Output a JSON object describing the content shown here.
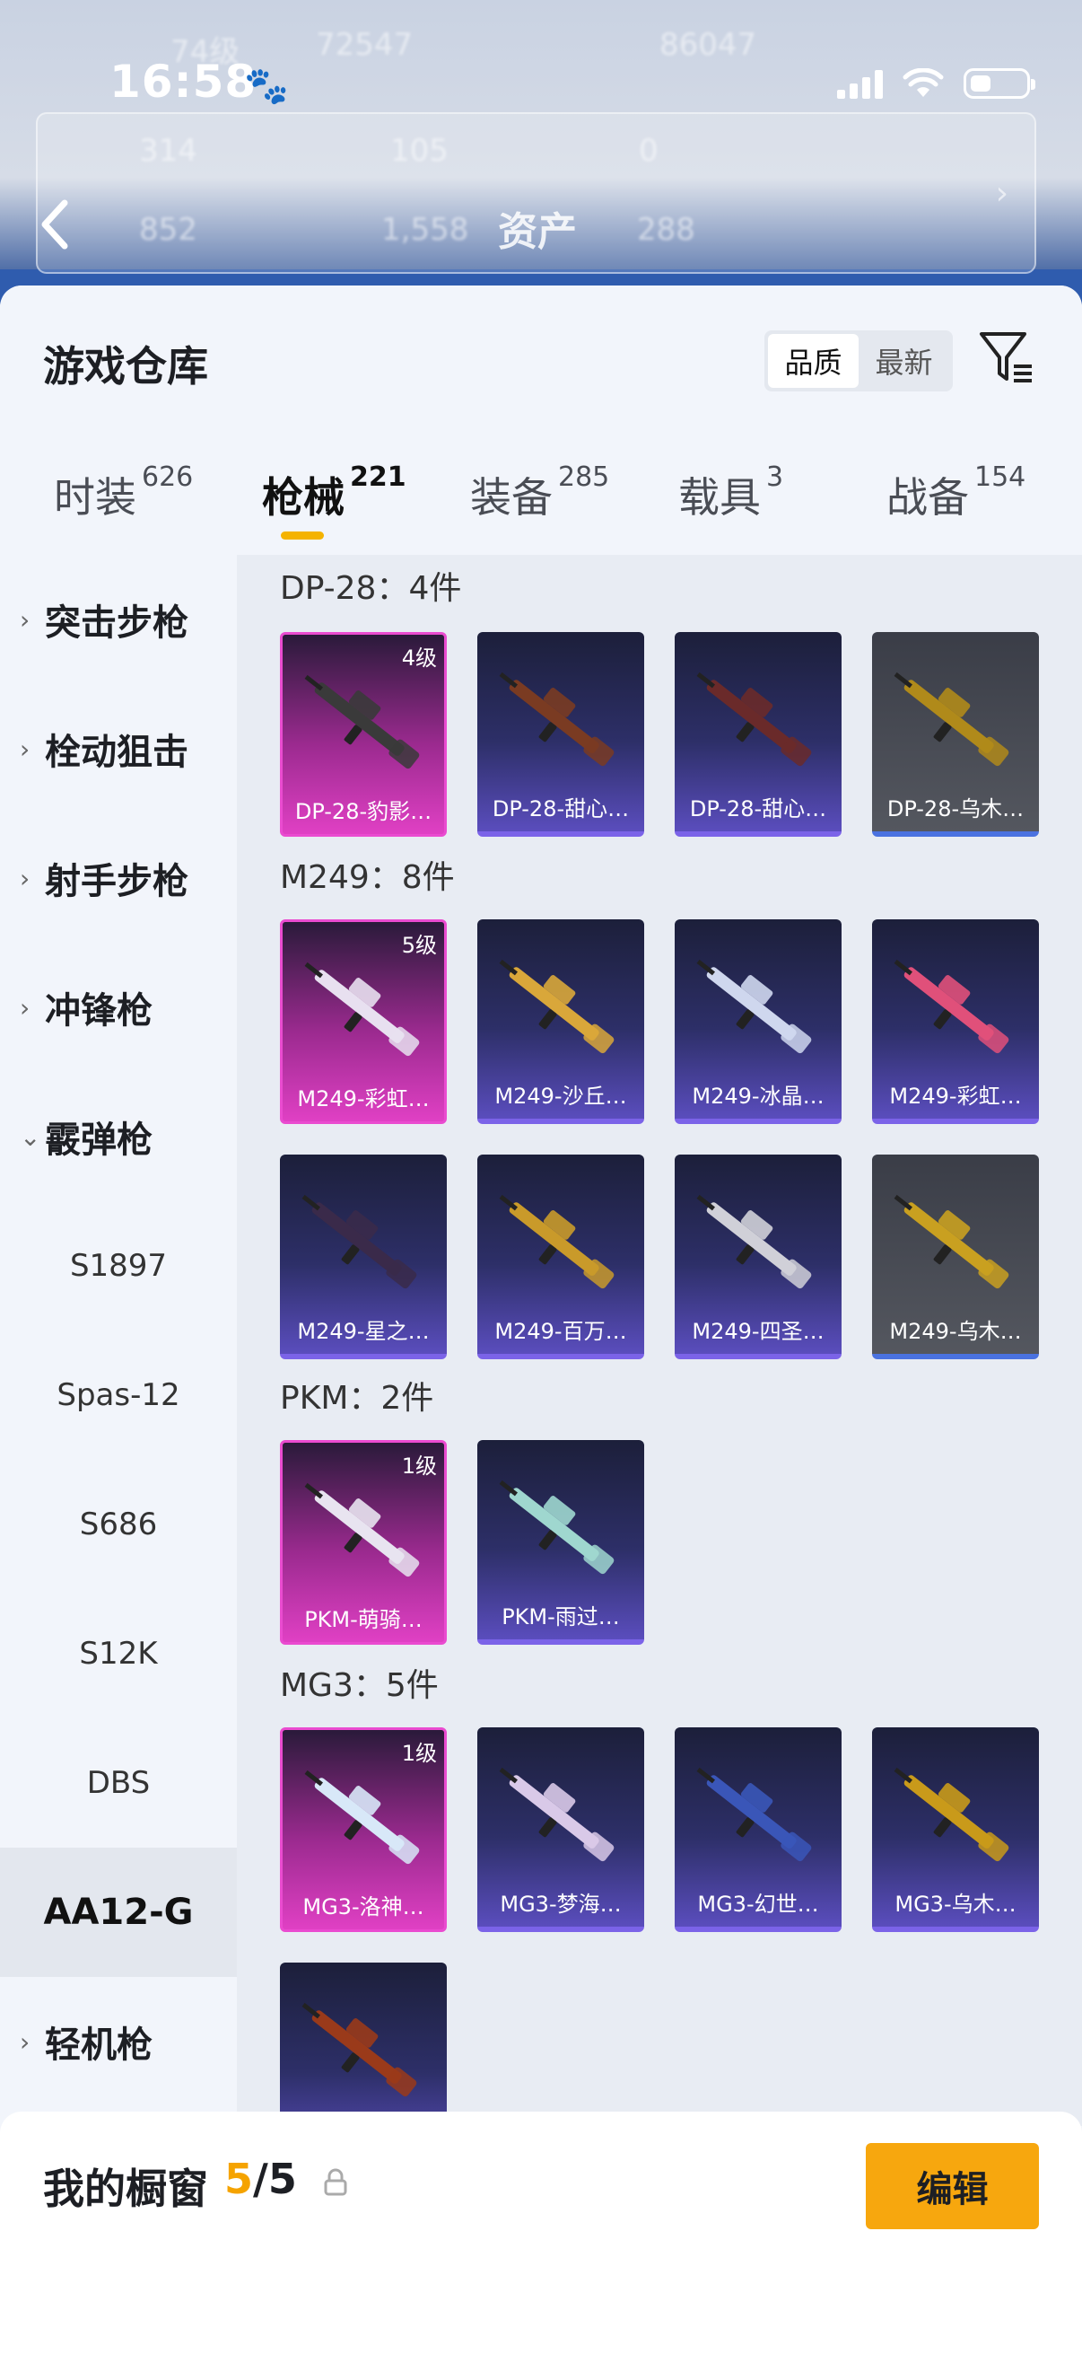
{
  "status_bar": {
    "time": "16:58"
  },
  "background": {
    "title": "资产",
    "ghost_stats": [
      "74级",
      "72547",
      "86047",
      "314",
      "105",
      "0",
      "852",
      "1,558",
      "288"
    ]
  },
  "header": {
    "title": "游戏仓库",
    "sort_options": [
      "品质",
      "最新"
    ],
    "sort_selected": "品质"
  },
  "tabs": [
    {
      "label": "时装",
      "count": "626"
    },
    {
      "label": "枪械",
      "count": "221",
      "active": true
    },
    {
      "label": "装备",
      "count": "285"
    },
    {
      "label": "载具",
      "count": "3"
    },
    {
      "label": "战备",
      "count": "154"
    }
  ],
  "sidebar": {
    "categories": [
      {
        "label": "突击步枪",
        "expanded": false
      },
      {
        "label": "栓动狙击",
        "expanded": false
      },
      {
        "label": "射手步枪",
        "expanded": false
      },
      {
        "label": "冲锋枪",
        "expanded": false
      },
      {
        "label": "霰弹枪",
        "expanded": true
      }
    ],
    "subitems": [
      "S1897",
      "Spas-12",
      "S686",
      "S12K",
      "DBS",
      "AA12-G"
    ],
    "selected": "AA12-G",
    "last_category": {
      "label": "轻机枪",
      "expanded": false
    }
  },
  "groups": [
    {
      "title": "DP-28：4件",
      "items": [
        {
          "name": "DP-28-豹影…",
          "level": "4级",
          "tier": "pink",
          "color": "#3a3a3a"
        },
        {
          "name": "DP-28-甜心…",
          "tier": "purple",
          "color": "#7a3b22"
        },
        {
          "name": "DP-28-甜心…",
          "tier": "purple",
          "color": "#6a2a2a"
        },
        {
          "name": "DP-28-乌木…",
          "tier": "grey",
          "color": "#b08a1a"
        }
      ]
    },
    {
      "title": "M249：8件",
      "items": [
        {
          "name": "M249-彩虹…",
          "level": "5级",
          "tier": "pink",
          "color": "#e8e0f0"
        },
        {
          "name": "M249-沙丘…",
          "tier": "purple",
          "color": "#d9a73a"
        },
        {
          "name": "M249-冰晶…",
          "tier": "purple",
          "color": "#cfd7ee"
        },
        {
          "name": "M249-彩虹…",
          "tier": "purple",
          "color": "#e0507a"
        },
        {
          "name": "M249-星之…",
          "tier": "purple",
          "color": "#3a2a4a"
        },
        {
          "name": "M249-百万…",
          "tier": "purple",
          "color": "#c99a2a"
        },
        {
          "name": "M249-四圣…",
          "tier": "purple",
          "color": "#d0d0d8"
        },
        {
          "name": "M249-乌木…",
          "tier": "grey",
          "color": "#c9a020"
        }
      ]
    },
    {
      "title": "PKM：2件",
      "items": [
        {
          "name": "PKM-萌骑…",
          "level": "1级",
          "tier": "pink",
          "color": "#e8e4f0"
        },
        {
          "name": "PKM-雨过…",
          "tier": "purple",
          "color": "#9fd7cf"
        }
      ]
    },
    {
      "title": "MG3：5件",
      "items": [
        {
          "name": "MG3-洛神…",
          "level": "1级",
          "tier": "pink",
          "color": "#d8e8f8"
        },
        {
          "name": "MG3-梦海…",
          "tier": "purple",
          "color": "#d9c9e8"
        },
        {
          "name": "MG3-幻世…",
          "tier": "purple",
          "color": "#3a56b8"
        },
        {
          "name": "MG3-乌木…",
          "tier": "purple",
          "color": "#c99a1a"
        },
        {
          "name": "",
          "tier": "purple",
          "color": "#9a3a1a"
        }
      ]
    }
  ],
  "bottom_bar": {
    "title": "我的橱窗",
    "count_current": "5",
    "count_sep": "/",
    "count_total": "5",
    "edit_label": "编辑"
  }
}
